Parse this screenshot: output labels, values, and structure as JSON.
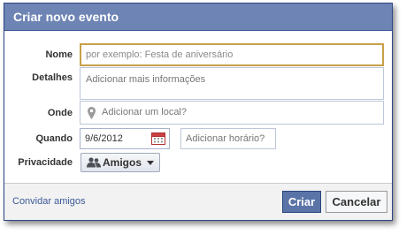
{
  "dialog": {
    "title": "Criar novo evento"
  },
  "form": {
    "name_label": "Nome",
    "name_placeholder": "por exemplo: Festa de aniversário",
    "details_label": "Detalhes",
    "details_placeholder": "Adicionar mais informações",
    "where_label": "Onde",
    "where_placeholder": "Adicionar um local?",
    "when_label": "Quando",
    "date_value": "9/6/2012",
    "time_placeholder": "Adicionar horário?",
    "privacy_label": "Privacidade",
    "privacy_value": "Amigos"
  },
  "footer": {
    "invite_link": "Convidar amigos",
    "create_button": "Criar",
    "cancel_button": "Cancelar"
  },
  "icons": {
    "where": "map-pin-icon",
    "date": "calendar-icon",
    "privacy": "people-icon",
    "privacy_dropdown": "chevron-down-icon"
  },
  "colors": {
    "titlebar": "#6d84b4",
    "primary_button": "#5b74a8",
    "link": "#3b5998",
    "focus_border": "#c8a04a"
  }
}
